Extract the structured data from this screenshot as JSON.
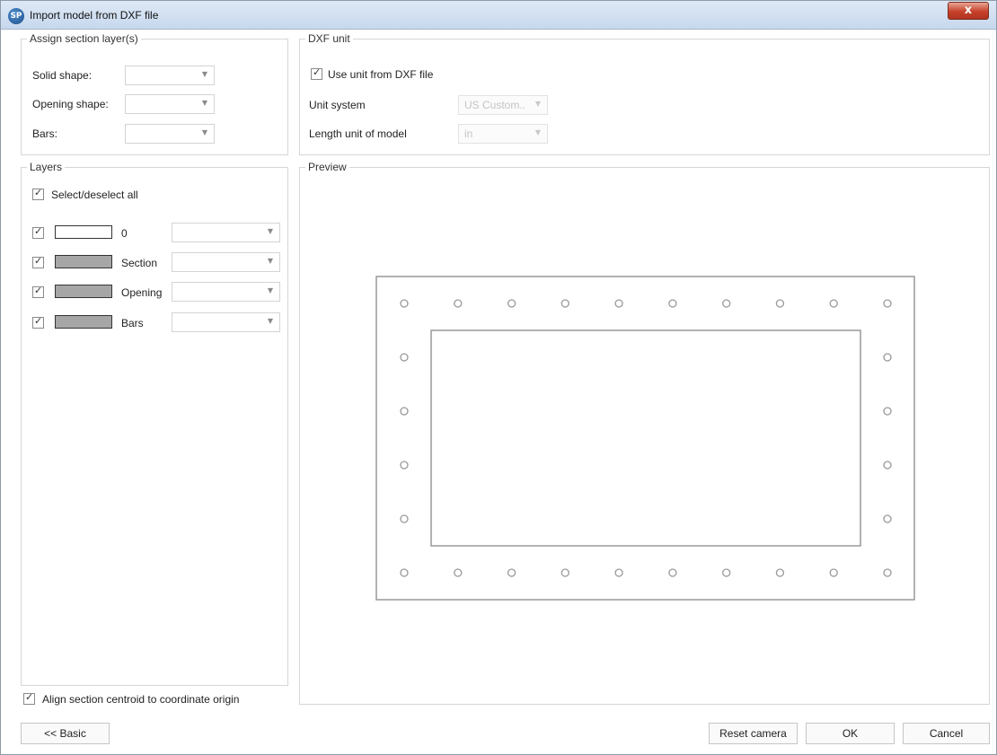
{
  "window": {
    "icon_text": "SP",
    "title": "Import model from DXF file",
    "close_glyph": "x"
  },
  "assign_section": {
    "title": "Assign section layer(s)",
    "rows": [
      {
        "label": "Solid shape:",
        "value": ""
      },
      {
        "label": "Opening shape:",
        "value": ""
      },
      {
        "label": "Bars:",
        "value": ""
      }
    ]
  },
  "dxf_unit": {
    "title": "DXF unit",
    "use_unit_label": "Use unit from DXF file",
    "use_unit_checked": true,
    "unit_system_label": "Unit system",
    "unit_system_value": "US Custom...",
    "length_unit_label": "Length unit of model",
    "length_unit_value": "in"
  },
  "layers": {
    "title": "Layers",
    "select_all_label": "Select/deselect all",
    "select_all_checked": true,
    "items": [
      {
        "name": "0",
        "checked": true,
        "color": "#ffffff",
        "assignment": ""
      },
      {
        "name": "Section",
        "checked": true,
        "color": "#a6a6a6",
        "assignment": ""
      },
      {
        "name": "Opening",
        "checked": true,
        "color": "#a6a6a6",
        "assignment": ""
      },
      {
        "name": "Bars",
        "checked": true,
        "color": "#a6a6a6",
        "assignment": ""
      }
    ]
  },
  "preview": {
    "title": "Preview",
    "outer_rect": "solid shape",
    "inner_rect": "opening shape",
    "bar_grid": {
      "columns": 10,
      "rows": 6
    }
  },
  "align_centroid": {
    "label": "Align section centroid to coordinate origin",
    "checked": true
  },
  "buttons": {
    "basic": "<< Basic",
    "reset_camera": "Reset camera",
    "ok": "OK",
    "cancel": "Cancel"
  },
  "icons": {
    "close": "close-icon",
    "check": "check-icon",
    "dropdown": "chevron-down-icon"
  },
  "colors": {
    "titlebar": "#c6d8ee",
    "close_button": "#c7412a",
    "layer_swatch": "#a6a6a6"
  }
}
